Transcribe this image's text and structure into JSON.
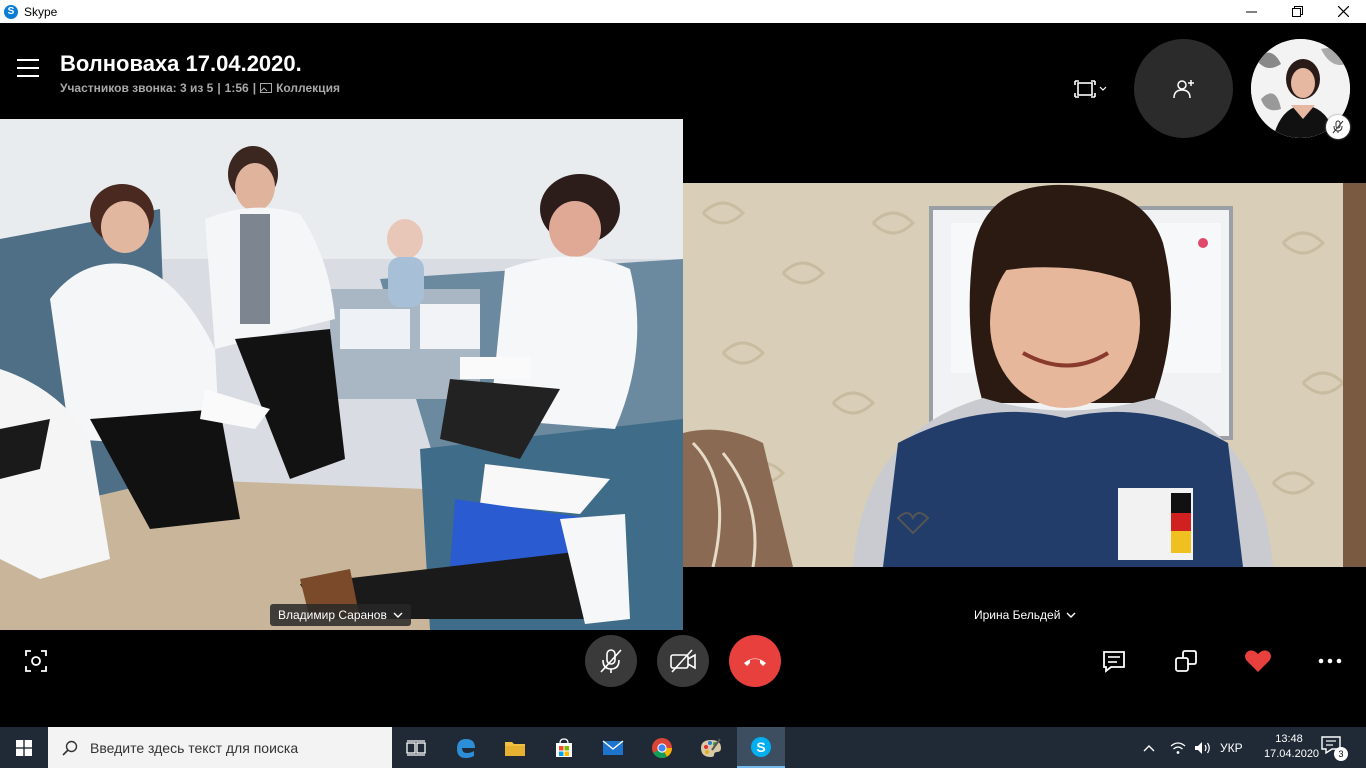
{
  "window": {
    "title": "Skype",
    "app_icon_letter": "S"
  },
  "call": {
    "title": "Волноваха 17.04.2020.",
    "participants": "Участников звонка: 3 из 5",
    "duration": "1:56",
    "collection": "Коллекция"
  },
  "participants": {
    "left_name": "Владимир Саранов",
    "right_name": "Ирина Бельдей"
  },
  "taskbar": {
    "search_placeholder": "Введите здесь текст для поиска",
    "language": "УКР",
    "time": "13:48",
    "date": "17.04.2020",
    "notification_count": "3"
  },
  "colors": {
    "end_call": "#e8403c",
    "heart": "#e8403c",
    "skype_blue": "#0a7dd6",
    "taskbar": "#1f2a36"
  }
}
